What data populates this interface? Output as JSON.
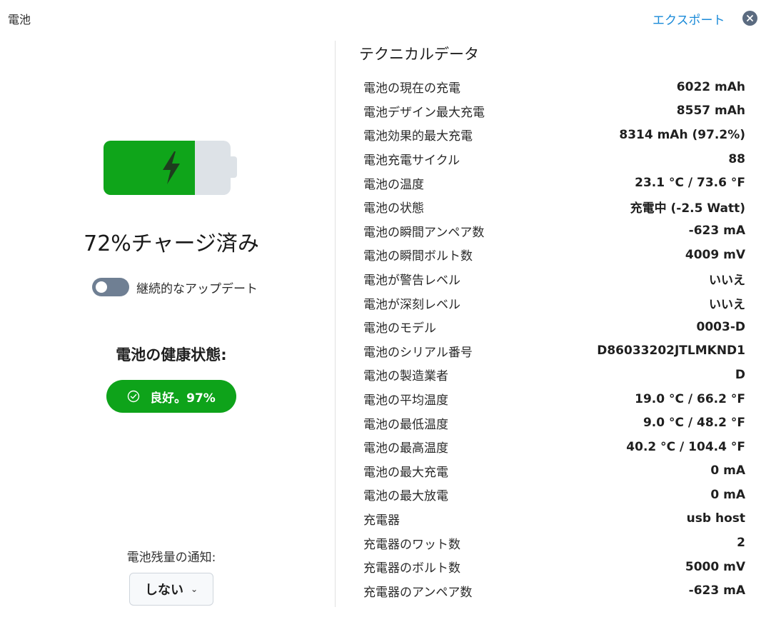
{
  "window": {
    "title": "電池",
    "export_label": "エクスポート",
    "close_icon": "close-icon"
  },
  "battery": {
    "charge_fraction": 0.72,
    "charge_label": "72%チャージ済み",
    "fill_color": "#0fa51a",
    "icon": "lightning-bolt-icon"
  },
  "toggle": {
    "label": "継続的なアップデート",
    "state": "off"
  },
  "health": {
    "title": "電池の健康状態:",
    "badge": "良好。97%",
    "badge_color": "#0ea31a",
    "icon": "check-circle-icon"
  },
  "notify": {
    "label": "電池残量の通知:",
    "selected": "しない"
  },
  "tech": {
    "title": "テクニカルデータ",
    "rows": [
      {
        "key": "電池の現在の充電",
        "value": "6022 mAh"
      },
      {
        "key": "電池デザイン最大充電",
        "value": "8557 mAh"
      },
      {
        "key": "電池効果的最大充電",
        "value": "8314 mAh (97.2%)"
      },
      {
        "key": "電池充電サイクル",
        "value": "88"
      },
      {
        "key": "電池の温度",
        "value": "23.1 °C / 73.6 °F"
      },
      {
        "key": "電池の状態",
        "value": "充電中 (-2.5 Watt)"
      },
      {
        "key": "電池の瞬間アンペア数",
        "value": "-623 mA"
      },
      {
        "key": "電池の瞬間ボルト数",
        "value": "4009 mV"
      },
      {
        "key": "電池が警告レベル",
        "value": "いいえ"
      },
      {
        "key": "電池が深刻レベル",
        "value": "いいえ"
      },
      {
        "key": "電池のモデル",
        "value": "0003-D"
      },
      {
        "key": "電池のシリアル番号",
        "value": "D86033202JTLMKND1"
      },
      {
        "key": "電池の製造業者",
        "value": "D"
      },
      {
        "key": "電池の平均温度",
        "value": "19.0 °C / 66.2 °F"
      },
      {
        "key": "電池の最低温度",
        "value": "9.0 °C / 48.2 °F"
      },
      {
        "key": "電池の最高温度",
        "value": "40.2 °C / 104.4 °F"
      },
      {
        "key": "電池の最大充電",
        "value": "0 mA"
      },
      {
        "key": "電池の最大放電",
        "value": "0 mA"
      },
      {
        "key": "充電器",
        "value": "usb host"
      },
      {
        "key": "充電器のワット数",
        "value": "2"
      },
      {
        "key": "充電器のボルト数",
        "value": "5000 mV"
      },
      {
        "key": "充電器のアンペア数",
        "value": "-623 mA"
      }
    ]
  }
}
